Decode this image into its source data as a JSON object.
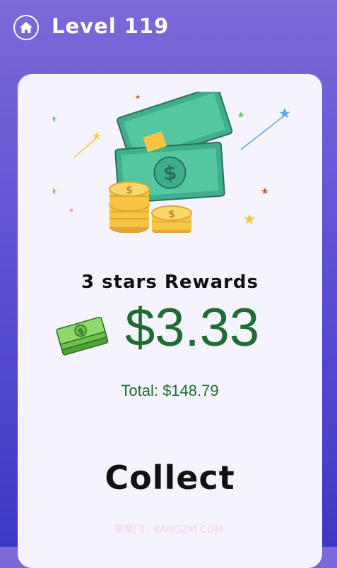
{
  "header": {
    "home_icon": "home-icon",
    "level_title": "Level 119"
  },
  "reward": {
    "title": "3 stars Rewards",
    "amount": "$3.33",
    "total": "Total: $148.79"
  },
  "actions": {
    "collect_label": "Collect"
  },
  "watermark": "康栗门 - KANGZM.COM",
  "colors": {
    "bg_top": "#7b6ad8",
    "bg_bottom": "#3f38c4",
    "card": "#f5f3fc",
    "money_green": "#1f6b34",
    "coin_gold": "#f7c542"
  }
}
